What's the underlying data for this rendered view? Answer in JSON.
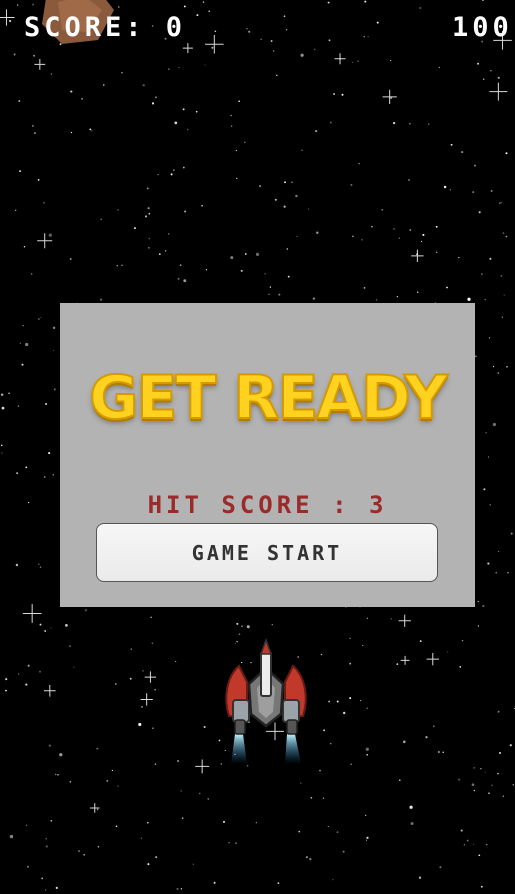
{
  "hud": {
    "score_text": "SCORE: 0",
    "hp_text": "100"
  },
  "panel": {
    "title": "GET READY",
    "hit_score_text": "HIT SCORE : 3",
    "start_button_label": "GAME START"
  },
  "colors": {
    "background": "#000000",
    "panel": "#b3b3b3",
    "title": "#ffd21f",
    "hit_score": "#9b2b2b",
    "ship_accent": "#c0392b"
  },
  "icons": [
    "asteroid-icon",
    "spaceship-icon"
  ]
}
